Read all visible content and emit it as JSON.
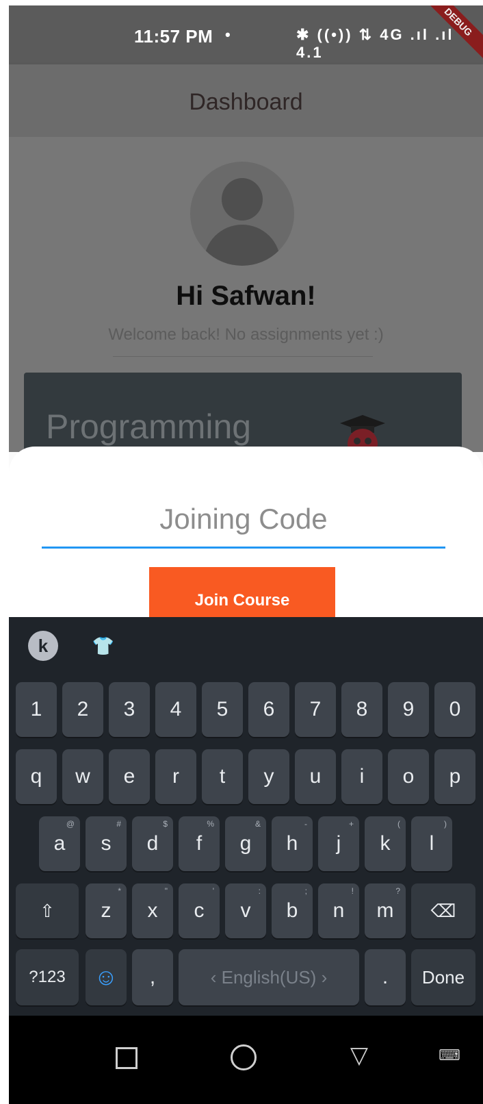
{
  "status_bar": {
    "time": "11:57 PM",
    "dot": "•",
    "icons": "✱ ((•)) ⇅ 4G .ıl .ıl 4.1",
    "debug_label": "DEBUG"
  },
  "app_bar": {
    "title": "Dashboard"
  },
  "dashboard": {
    "greeting": "Hi Safwan!",
    "welcome": "Welcome back! No assignments yet :)",
    "course_title": "Programming"
  },
  "sheet": {
    "input_placeholder": "Joining Code",
    "join_label": "Join Course",
    "accent_color": "#2196f3",
    "button_color": "#f95a22"
  },
  "keyboard": {
    "toolbar_k": "k",
    "toolbar_theme": "👕",
    "number_row": [
      "1",
      "2",
      "3",
      "4",
      "5",
      "6",
      "7",
      "8",
      "9",
      "0"
    ],
    "row1": [
      "q",
      "w",
      "e",
      "r",
      "t",
      "y",
      "u",
      "i",
      "o",
      "p"
    ],
    "row2": [
      "a",
      "s",
      "d",
      "f",
      "g",
      "h",
      "j",
      "k",
      "l"
    ],
    "row2_hints": [
      "@",
      "#",
      "$",
      "%",
      "&",
      "-",
      "+",
      "(",
      ")"
    ],
    "row3": [
      "z",
      "x",
      "c",
      "v",
      "b",
      "n",
      "m"
    ],
    "row3_hints": [
      "*",
      "\"",
      "'",
      ":",
      ";",
      "!",
      "?"
    ],
    "shift": "⇧",
    "backspace": "⌫",
    "symbols": "?123",
    "emoji": "☺",
    "comma": ",",
    "space": "‹  English(US)  ›",
    "period": ".",
    "done": "Done"
  },
  "nav_bar": {
    "back": "▽",
    "keyboard": "⌨"
  }
}
